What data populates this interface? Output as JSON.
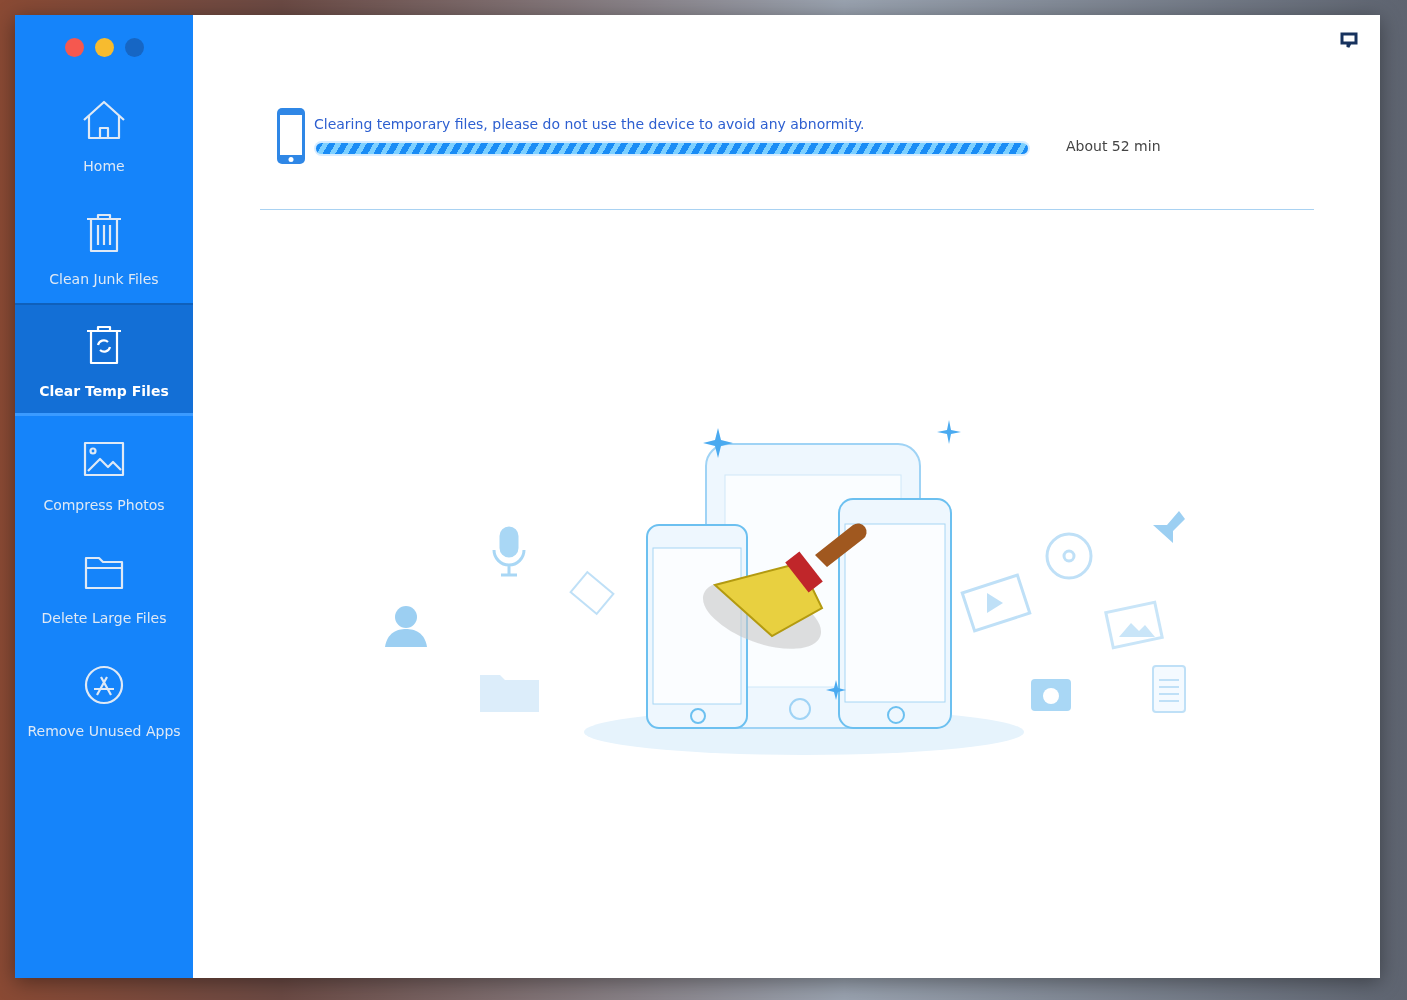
{
  "sidebar": {
    "items": [
      {
        "label": "Home",
        "selected": false
      },
      {
        "label": "Clean Junk Files",
        "selected": false
      },
      {
        "label": "Clear Temp Files",
        "selected": true
      },
      {
        "label": "Compress Photos",
        "selected": false
      },
      {
        "label": "Delete Large Files",
        "selected": false
      },
      {
        "label": "Remove Unused Apps",
        "selected": false
      }
    ]
  },
  "progress": {
    "message": "Clearing temporary files, please do not use the device to avoid any abnormity.",
    "level": 1,
    "remaining": "About 52 min"
  }
}
